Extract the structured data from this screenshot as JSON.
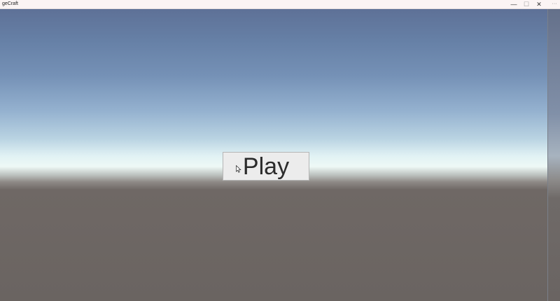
{
  "window": {
    "title": "geCraft",
    "controls": {
      "minimize": "—",
      "maximize": "☐",
      "close": "✕",
      "extra": "···"
    }
  },
  "menu": {
    "play_label": "Play"
  },
  "colors": {
    "sky_top": "#5e7197",
    "horizon": "#eef9f6",
    "ground": "#6a6461",
    "button_bg": "#ececec"
  },
  "icons": {
    "cursor": "mouse-pointer-icon"
  }
}
